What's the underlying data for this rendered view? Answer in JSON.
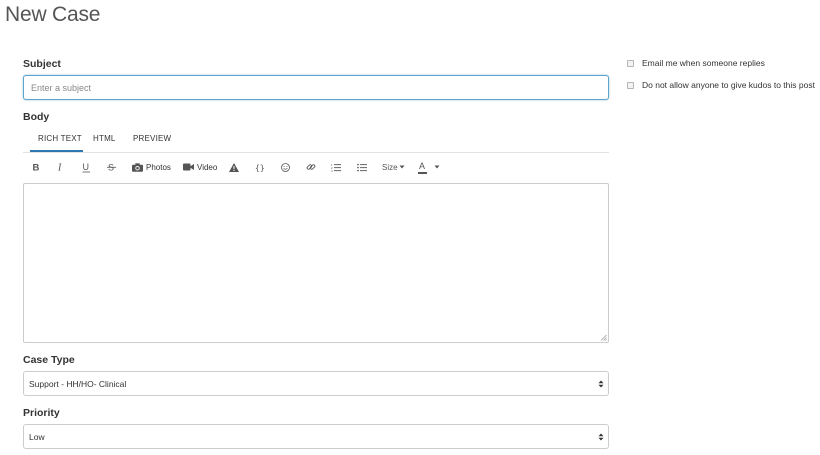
{
  "page": {
    "title": "New Case"
  },
  "subject": {
    "label": "Subject",
    "placeholder": "Enter a subject",
    "value": ""
  },
  "body": {
    "label": "Body",
    "tabs": [
      {
        "label": "RICH TEXT",
        "active": true
      },
      {
        "label": "HTML",
        "active": false
      },
      {
        "label": "PREVIEW",
        "active": false
      }
    ],
    "toolbar": {
      "bold_icon": "bold-icon",
      "italic_icon": "italic-icon",
      "underline_icon": "underline-icon",
      "strike_icon": "strikethrough-icon",
      "photos_label": "Photos",
      "video_label": "Video",
      "spoiler_icon": "warning-icon",
      "code_icon": "code-braces-icon",
      "emoji_icon": "emoji-icon",
      "link_icon": "link-icon",
      "ordered_list_icon": "ordered-list-icon",
      "bullet_list_icon": "bullet-list-icon",
      "size_label": "Size",
      "font_color_label": "A"
    },
    "content": ""
  },
  "case_type": {
    "label": "Case Type",
    "value": "Support - HH/HO- Clinical"
  },
  "priority": {
    "label": "Priority",
    "value": "Low"
  },
  "options": {
    "email_me_label": "Email me when someone replies",
    "no_kudos_label": "Do not allow anyone to give kudos to this post"
  },
  "colors": {
    "accent": "#2f77b1",
    "focus_border": "#5ea3c9",
    "border": "#cccccc"
  }
}
